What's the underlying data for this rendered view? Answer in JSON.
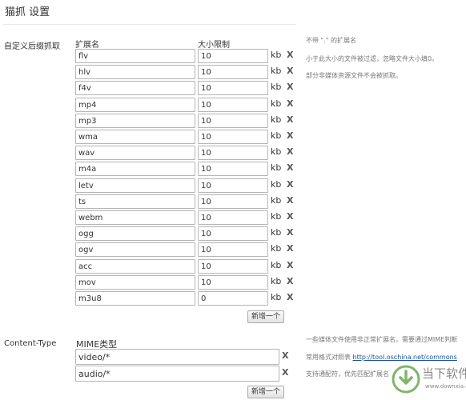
{
  "page": {
    "title": "猫抓 设置"
  },
  "suffix": {
    "section_label": "自定义后缀抓取",
    "col_ext": "扩展名",
    "col_size": "大小限制",
    "unit": "kb",
    "delete_glyph": "X",
    "rows": [
      {
        "ext": "flv",
        "size": "10"
      },
      {
        "ext": "hlv",
        "size": "10"
      },
      {
        "ext": "f4v",
        "size": "10"
      },
      {
        "ext": "mp4",
        "size": "10"
      },
      {
        "ext": "mp3",
        "size": "10"
      },
      {
        "ext": "wma",
        "size": "10"
      },
      {
        "ext": "wav",
        "size": "10"
      },
      {
        "ext": "m4a",
        "size": "10"
      },
      {
        "ext": "letv",
        "size": "10"
      },
      {
        "ext": "ts",
        "size": "10"
      },
      {
        "ext": "webm",
        "size": "10"
      },
      {
        "ext": "ogg",
        "size": "10"
      },
      {
        "ext": "ogv",
        "size": "10"
      },
      {
        "ext": "acc",
        "size": "10"
      },
      {
        "ext": "mov",
        "size": "10"
      },
      {
        "ext": "m3u8",
        "size": "0"
      }
    ],
    "add_button": "新增一个",
    "hints": [
      "不带 \".\" 的扩展名",
      "小于此大小的文件被过滤，忽略文件大小填0。",
      "部分非媒体资源文件不会被抓取。"
    ]
  },
  "mime": {
    "section_label": "Content-Type",
    "col_head": "MIME类型",
    "delete_glyph": "X",
    "rows": [
      {
        "value": "video/*"
      },
      {
        "value": "audio/*"
      }
    ],
    "add_button": "新增一个",
    "hint1": "一些媒体文件使用非正常扩展名，需要通过MIME判断",
    "hint2_prefix": "常用格式对照表",
    "hint2_link": "http://tool.oschina.net/commons",
    "hint3": "支持通配符，优先匹配扩展名"
  },
  "watermark": {
    "text": "当下软件园",
    "url": "www.downxia.com",
    "color": "#6aa84f"
  }
}
